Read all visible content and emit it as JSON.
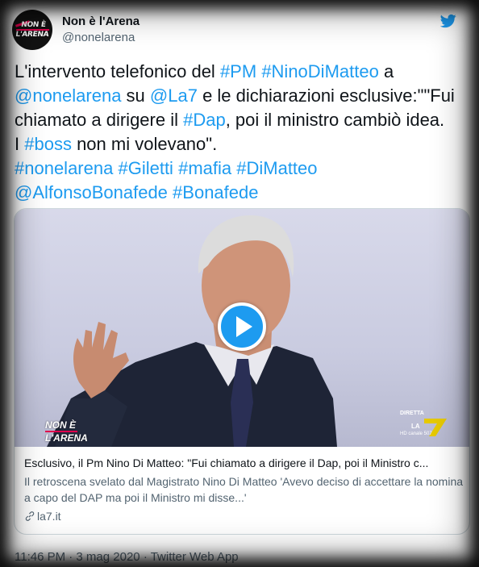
{
  "author": {
    "display_name": "Non è l'Arena",
    "handle": "@nonelarena",
    "avatar_logo_line1": "NON È",
    "avatar_logo_line2": "L'ARENA"
  },
  "tweet": {
    "segments": [
      {
        "text": "L'intervento telefonico del ",
        "link": false
      },
      {
        "text": "#PM",
        "link": true
      },
      {
        "text": " ",
        "link": false
      },
      {
        "text": "#NinoDiMatteo",
        "link": true
      },
      {
        "text": " a\n",
        "link": false
      },
      {
        "text": "@nonelarena",
        "link": true
      },
      {
        "text": " su ",
        "link": false
      },
      {
        "text": "@La7",
        "link": true
      },
      {
        "text": " e le dichiarazioni esclusive:\"\"Fui\nchiamato a dirigere il ",
        "link": false
      },
      {
        "text": "#Dap",
        "link": true
      },
      {
        "text": ", poi il ministro cambiò idea.\nI ",
        "link": false
      },
      {
        "text": "#boss",
        "link": true
      },
      {
        "text": " non mi volevano\".\n",
        "link": false
      },
      {
        "text": "#nonelarena",
        "link": true
      },
      {
        "text": " ",
        "link": false
      },
      {
        "text": "#Giletti",
        "link": true
      },
      {
        "text": " ",
        "link": false
      },
      {
        "text": "#mafia",
        "link": true
      },
      {
        "text": " ",
        "link": false
      },
      {
        "text": "#DiMatteo",
        "link": true
      },
      {
        "text": "\n",
        "link": false
      },
      {
        "text": "@AlfonsoBonafede",
        "link": true
      },
      {
        "text": " ",
        "link": false
      },
      {
        "text": "#Bonafede",
        "link": true
      }
    ]
  },
  "card": {
    "title": "Esclusivo, il Pm Nino Di Matteo: \"Fui chiamato a dirigere il Dap, poi il Ministro c...",
    "description": "Il retroscena svelato dal Magistrato Nino Di Matteo 'Avevo deciso di accettare la nomina a capo del DAP ma poi il Ministro mi disse...'",
    "domain": "la7.it",
    "overlay_show_line1": "NON È",
    "overlay_show_line2": "L'ARENA",
    "overlay_diretta": "DIRETTA",
    "overlay_canale": "HD canale 507"
  },
  "footer": {
    "timestamp": "11:46 PM · 3 mag 2020 · Twitter Web App"
  },
  "colors": {
    "link": "#1d9bf0",
    "text": "#0f1419",
    "muted": "#536471",
    "border": "#cfd9de",
    "brand_accent": "#e0004d"
  },
  "icons": [
    "twitter-bird-icon",
    "play-icon",
    "link-icon"
  ]
}
